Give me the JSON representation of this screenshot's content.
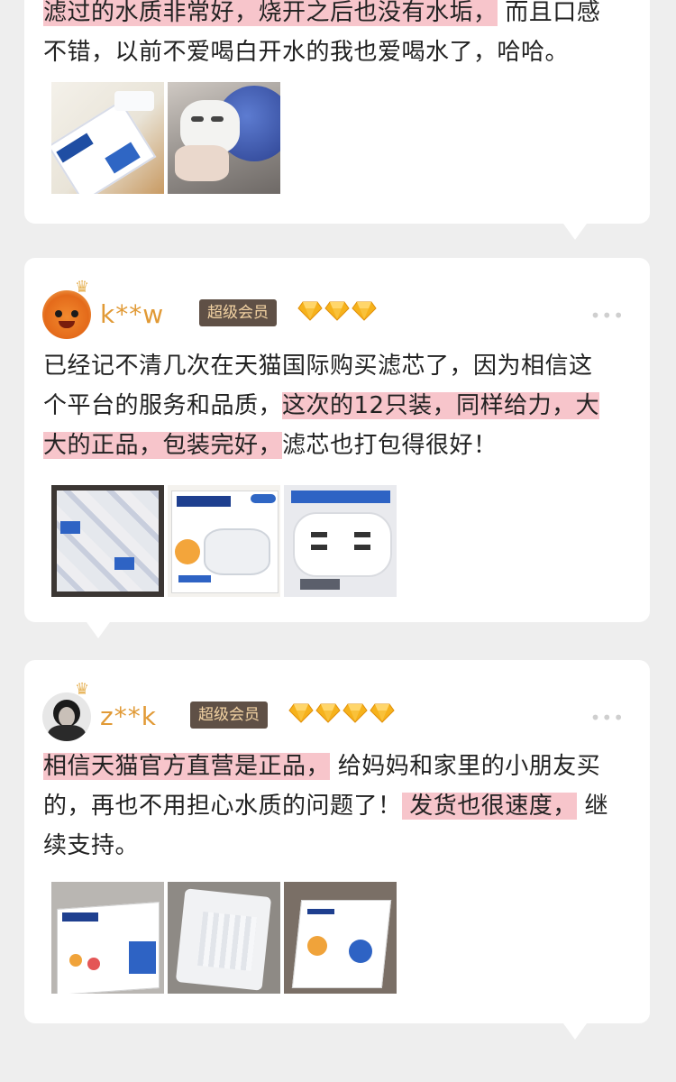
{
  "review1": {
    "lines": [
      {
        "segments": [
          {
            "t": "滤过的水质非常好，烧开之后也没有水垢，",
            "hl": true
          },
          {
            "t": " 而且口感",
            "hl": false
          }
        ]
      },
      {
        "segments": [
          {
            "t": "不错，以前不爱喝白开水的我也爱喝水了，哈哈。",
            "hl": false
          }
        ]
      }
    ],
    "images": [
      "brita-box-photo",
      "filter-in-pitcher-photo"
    ]
  },
  "review2": {
    "username": "k**w",
    "badge": "超级会员",
    "gem_count": 3,
    "more": "•••",
    "lines": [
      {
        "segments": [
          {
            "t": "已经记不清几次在天猫国际购买滤芯了，因为相信这",
            "hl": false
          }
        ]
      },
      {
        "segments": [
          {
            "t": "个平台的服务和品质，",
            "hl": false
          },
          {
            "t": "这次的12只装，同样给力，大",
            "hl": true
          }
        ]
      },
      {
        "segments": [
          {
            "t": "大的正品，包装完好，",
            "hl": true
          },
          {
            "t": "滤芯也打包得很好！",
            "hl": false
          }
        ]
      }
    ],
    "images": [
      "stacked-filters-photo",
      "maxtra-12-box-photo",
      "filter-cartridge-photo"
    ]
  },
  "review3": {
    "username": "z**k",
    "badge": "超级会员",
    "gem_count": 4,
    "more": "•••",
    "lines": [
      {
        "segments": [
          {
            "t": "相信天猫官方直营是正品，",
            "hl": true
          },
          {
            "t": " 给妈妈和家里的小朋友买",
            "hl": false
          }
        ]
      },
      {
        "segments": [
          {
            "t": "的，再也不用担心水质的问题了！",
            "hl": false
          },
          {
            "t": " 发货也很速度，",
            "hl": true
          },
          {
            "t": " 继",
            "hl": false
          }
        ]
      },
      {
        "segments": [
          {
            "t": "续支持。",
            "hl": false
          }
        ]
      }
    ],
    "images": [
      "brita-box-on-table-photo",
      "wrapped-package-photo",
      "brita-box-angled-photo"
    ]
  },
  "colors": {
    "highlight": "#f7c5cb",
    "username": "#e19a36",
    "badge_bg": "#5f5046",
    "badge_text": "#f3d3a3",
    "gem": "#f6b21b"
  }
}
